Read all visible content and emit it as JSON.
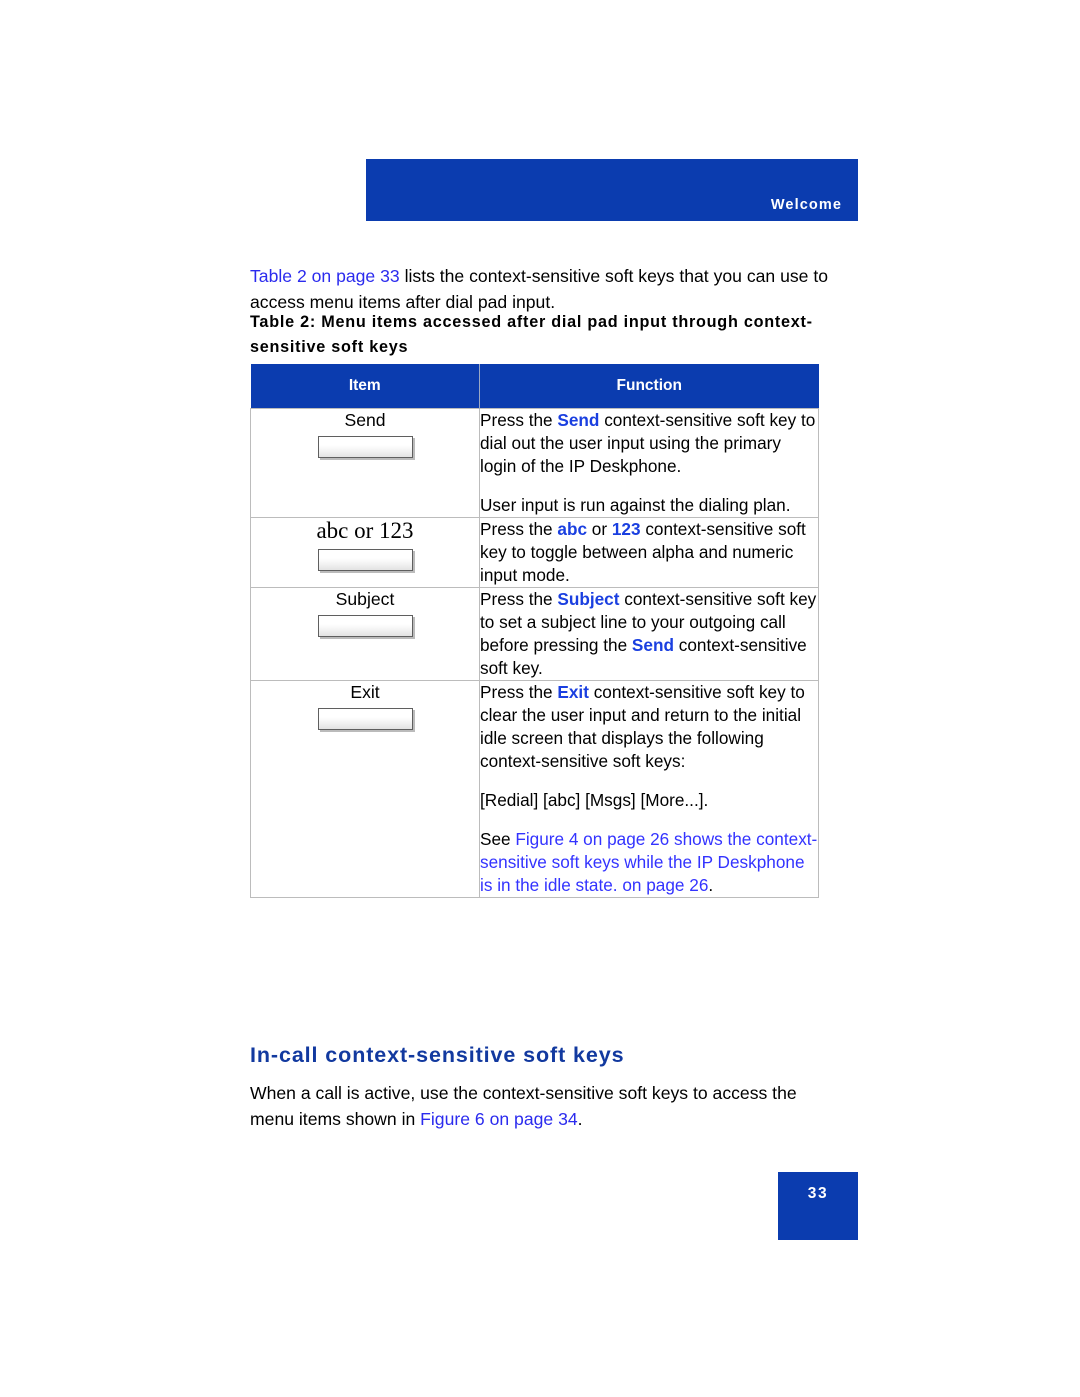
{
  "header": {
    "running_head": "Welcome"
  },
  "intro": {
    "link_text": "Table 2 on page 33",
    "rest": " lists the context-sensitive soft keys that you can use to access menu items after dial pad input."
  },
  "table_caption": "Table 2: Menu items accessed after dial pad input through context-sensitive soft keys",
  "table": {
    "columns": [
      "Item",
      "Function"
    ],
    "rows": [
      {
        "item_label": "Send",
        "item_label_font": "sans",
        "item_graphic": "soft-key-button",
        "function_paragraphs": [
          {
            "segments": [
              {
                "text": "Press the ",
                "style": "plain"
              },
              {
                "text": "Send",
                "style": "keyword"
              },
              {
                "text": " context-sensitive soft key to dial out the user input using the primary login of the IP Deskphone.",
                "style": "plain"
              }
            ]
          },
          {
            "segments": [
              {
                "text": "User input is run against the dialing plan.",
                "style": "plain"
              }
            ]
          }
        ]
      },
      {
        "item_label": "abc or 123",
        "item_label_font": "serif",
        "item_graphic": "soft-key-button",
        "function_paragraphs": [
          {
            "segments": [
              {
                "text": "Press the ",
                "style": "plain"
              },
              {
                "text": "abc",
                "style": "keyword"
              },
              {
                "text": " or ",
                "style": "plain"
              },
              {
                "text": "123",
                "style": "keyword"
              },
              {
                "text": " context-sensitive soft key to toggle between alpha and numeric input mode.",
                "style": "plain"
              }
            ]
          }
        ]
      },
      {
        "item_label": "Subject",
        "item_label_font": "sans",
        "item_graphic": "soft-key-button",
        "function_paragraphs": [
          {
            "segments": [
              {
                "text": "Press the ",
                "style": "plain"
              },
              {
                "text": "Subject",
                "style": "keyword"
              },
              {
                "text": " context-sensitive soft key to set a subject line to your outgoing call before pressing the ",
                "style": "plain"
              },
              {
                "text": "Send",
                "style": "keyword"
              },
              {
                "text": " context-sensitive soft key.",
                "style": "plain"
              }
            ]
          }
        ]
      },
      {
        "item_label": "Exit",
        "item_label_font": "sans",
        "item_graphic": "soft-key-button",
        "function_paragraphs": [
          {
            "segments": [
              {
                "text": "Press the ",
                "style": "plain"
              },
              {
                "text": "Exit",
                "style": "keyword"
              },
              {
                "text": " context-sensitive soft key to clear the user input and return to the initial idle screen that displays the following context-sensitive soft keys:",
                "style": "plain"
              }
            ]
          },
          {
            "segments": [
              {
                "text": "[Redial] [abc] [Msgs] [More...].",
                "style": "plain"
              }
            ]
          },
          {
            "segments": [
              {
                "text": "See ",
                "style": "plain"
              },
              {
                "text": " Figure 4 on page 26 shows the context-sensitive soft keys while the IP Deskphone is in the idle state.  on page 26",
                "style": "xref"
              },
              {
                "text": ".",
                "style": "plain"
              }
            ]
          }
        ]
      }
    ]
  },
  "section": {
    "heading": "In-call context-sensitive soft keys",
    "paragraph_prefix": "When a call is active, use the context-sensitive soft keys to access the menu items shown in ",
    "paragraph_link": "Figure 6 on page 34",
    "paragraph_suffix": "."
  },
  "footer": {
    "page_number": "33"
  },
  "colors": {
    "brand_blue": "#0b3caf",
    "link_blue": "#3333ff",
    "heading_blue": "#12399f",
    "keyword_blue": "#1a3fe0",
    "table_border": "#bcbcbc"
  }
}
